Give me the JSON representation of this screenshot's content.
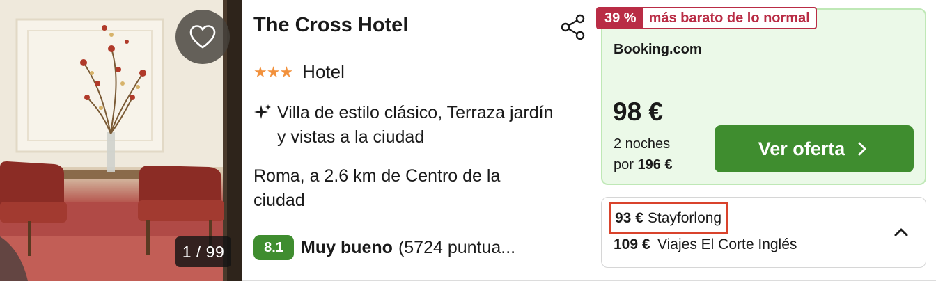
{
  "photo": {
    "counter": "1 / 99"
  },
  "hotel": {
    "name": "The Cross Hotel",
    "stars": "★★★",
    "type": "Hotel",
    "feature": "Villa de estilo clásico, Terraza jardín y vistas a la ciudad",
    "location": "Roma, a 2.6 km de Centro de la ciudad",
    "rating_score": "8.1",
    "rating_word": "Muy bueno",
    "reviews": "(5724 puntua..."
  },
  "deal": {
    "discount_pct": "39 %",
    "discount_label": "más barato de lo normal",
    "provider": "Booking.com",
    "price": "98 €",
    "nights_line1": "2 noches",
    "nights_prefix": "por",
    "total": "196 €",
    "cta_label": "Ver oferta"
  },
  "other_offers": [
    {
      "price": "93 €",
      "provider": "Stayforlong"
    },
    {
      "price": "109 €",
      "provider": "Viajes El Corte Inglés"
    }
  ],
  "colors": {
    "accent_green": "#3f8d2f",
    "deal_bg": "#ebf9e8",
    "discount_red": "#b92c45",
    "star_orange": "#f2913c",
    "highlight_box": "#d9432c"
  },
  "icons": [
    "heart-icon",
    "share-icon",
    "sparkle-icon",
    "chevron-right-icon",
    "chevron-up-icon"
  ]
}
